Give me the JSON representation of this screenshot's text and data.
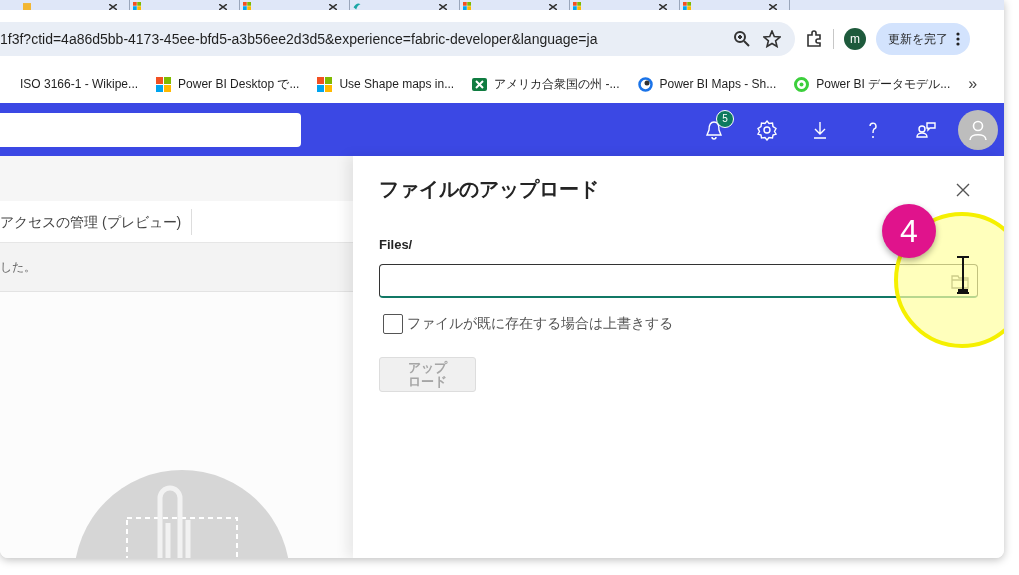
{
  "browser": {
    "tabs": [
      {
        "kind": "folder"
      },
      {
        "kind": "ms"
      },
      {
        "kind": "ms"
      },
      {
        "kind": "swirl"
      },
      {
        "kind": "ms"
      },
      {
        "kind": "ms"
      },
      {
        "kind": "ms"
      }
    ],
    "address": "1f3f?ctid=4a86d5bb-4173-45ee-bfd5-a3b56ee2d3d5&experience=fabric-developer&language=ja",
    "profile": "m",
    "update_button": "更新を完了",
    "bookmarks": [
      {
        "kind": "wiki",
        "label": "ISO 3166-1 - Wikipe..."
      },
      {
        "kind": "ms",
        "label": "Power BI Desktop で..."
      },
      {
        "kind": "ms",
        "label": "Use Shape maps in..."
      },
      {
        "kind": "excel",
        "label": "アメリカ合衆国の州 -..."
      },
      {
        "kind": "maps",
        "label": "Power BI Maps - Sh..."
      },
      {
        "kind": "ring",
        "label": "Power BI データモデル..."
      }
    ],
    "bookmarks_more": "»"
  },
  "app_header": {
    "notification_count": "5"
  },
  "background": {
    "toolbar_item": "アクセスの管理 (プレビュー)",
    "message": "した。"
  },
  "upload_panel": {
    "title": "ファイルのアップロード",
    "path_label": "Files/",
    "overwrite": {
      "label": "ファイルが既に存在する場合は上書きする",
      "checked": false
    },
    "upload_button": {
      "label": "アップロード",
      "disabled": true
    }
  },
  "annotation": {
    "step": "4"
  }
}
